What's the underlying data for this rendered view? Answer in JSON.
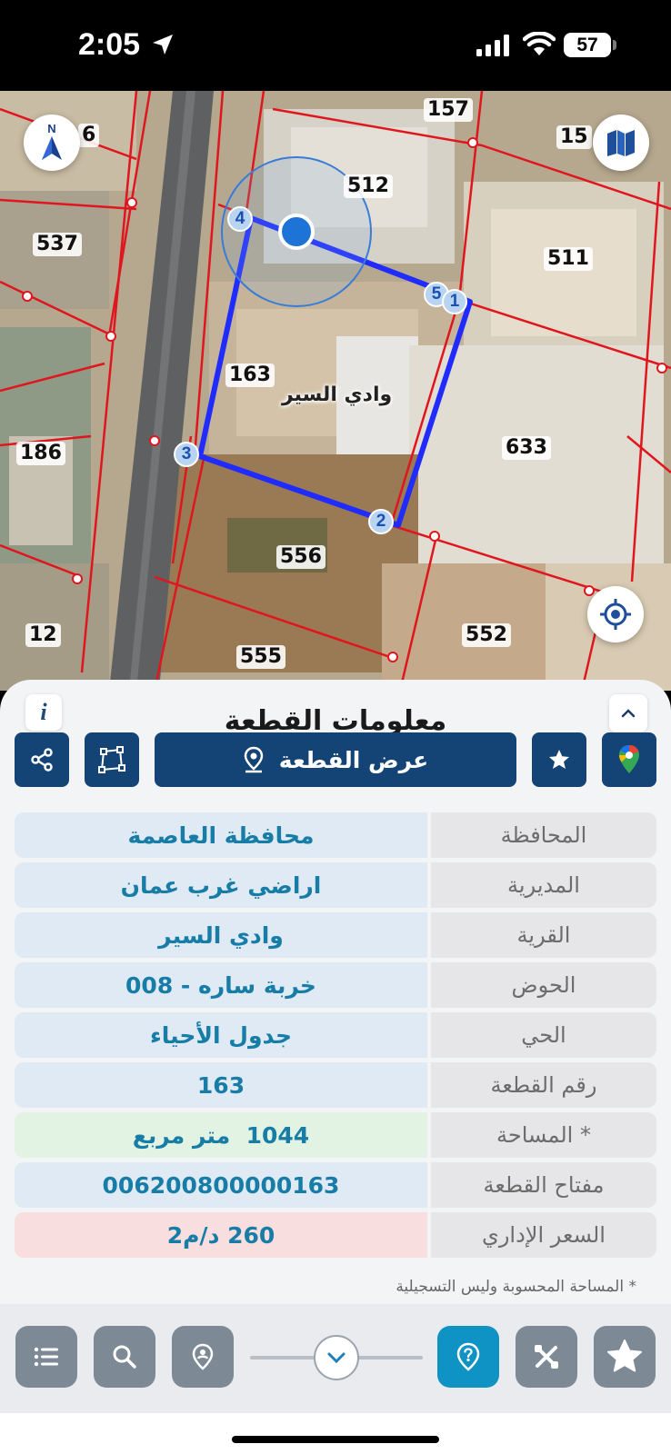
{
  "status_bar": {
    "time": "2:05",
    "battery": "57"
  },
  "map": {
    "village_label": "وادي السير",
    "parcels": [
      "157",
      "512",
      "537",
      "511",
      "163",
      "186",
      "633",
      "556",
      "12",
      "552",
      "555"
    ],
    "parcel_partials": [
      "6",
      "15"
    ],
    "vertices": [
      "4",
      "5",
      "1",
      "3",
      "2"
    ],
    "compass_letter": "N"
  },
  "panel": {
    "title": "معلومات القطعة",
    "info_label": "i",
    "show_parcel_label": "عرض القطعة",
    "rows": [
      {
        "key": "المحافظة",
        "value": "محافظة العاصمة"
      },
      {
        "key": "المديرية",
        "value": "اراضي غرب عمان"
      },
      {
        "key": "القرية",
        "value": "وادي السير"
      },
      {
        "key": "الحوض",
        "value": "خربة ساره - 008"
      },
      {
        "key": "الحي",
        "value": "جدول الأحياء"
      },
      {
        "key": "رقم القطعة",
        "value": "163"
      },
      {
        "key": "المساحة *",
        "value": "1044  متر مربع"
      },
      {
        "key": "مفتاح القطعة",
        "value": "006200800000163"
      },
      {
        "key": "السعر الإداري",
        "value": "260 د/م2"
      }
    ],
    "footnote": "* المساحة المحسوبة وليس التسجيلية"
  },
  "colors": {
    "navy": "#134475",
    "accent": "#0f93c4",
    "parcel_line": "#e0161e",
    "selection": "#1f2bff"
  }
}
